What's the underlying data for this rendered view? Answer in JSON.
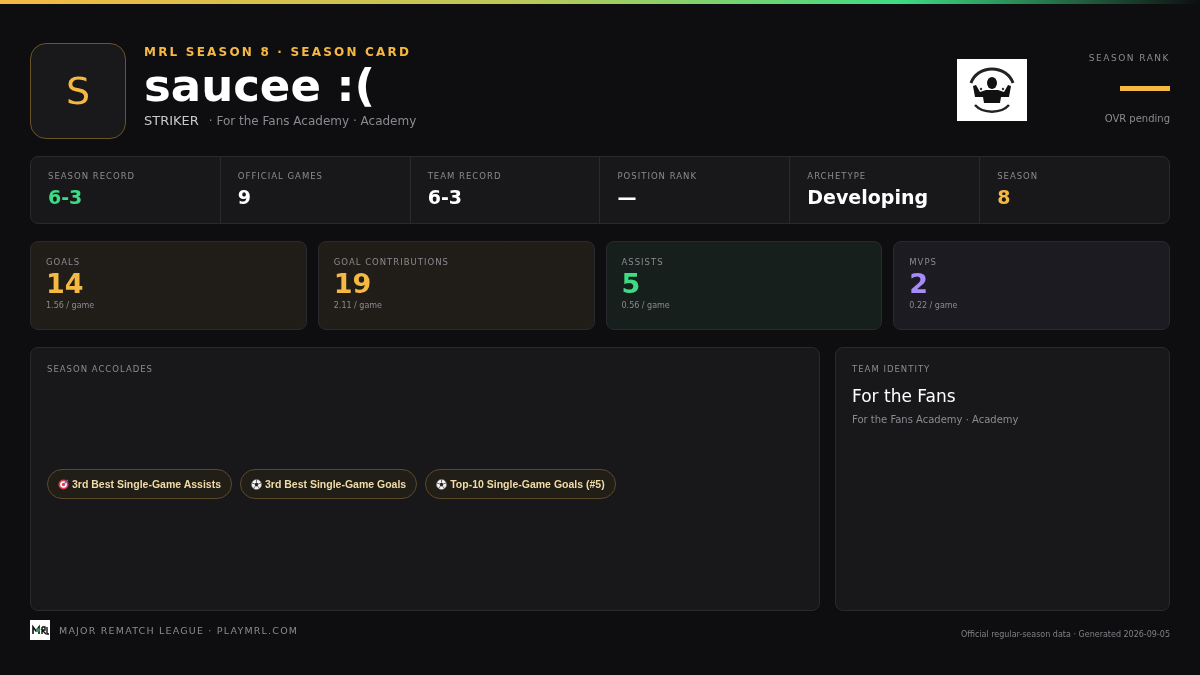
{
  "header": {
    "avatar_letter": "S",
    "eyebrow": "MRL SEASON 8 · SEASON CARD",
    "player_name": "saucee :(",
    "position": "STRIKER",
    "team_line": "· For the Fans Academy · Academy"
  },
  "season_rank": {
    "label": "SEASON RANK",
    "note": "OVR pending"
  },
  "summary": [
    {
      "label": "SEASON RECORD",
      "value": "6-3",
      "color": "#3ddc84"
    },
    {
      "label": "OFFICIAL GAMES",
      "value": "9",
      "color": "#ffffff"
    },
    {
      "label": "TEAM RECORD",
      "value": "6-3",
      "color": "#ffffff"
    },
    {
      "label": "POSITION RANK",
      "value": "—",
      "color": "#ffffff"
    },
    {
      "label": "ARCHETYPE",
      "value": "Developing",
      "color": "#ffffff"
    },
    {
      "label": "SEASON",
      "value": "8",
      "color": "#f5b942"
    }
  ],
  "stat_cards": [
    {
      "label": "GOALS",
      "value": "14",
      "per_game": "1.56 / game",
      "color": "#f5b942"
    },
    {
      "label": "GOAL CONTRIBUTIONS",
      "value": "19",
      "per_game": "2.11 / game",
      "color": "#f5b942"
    },
    {
      "label": "ASSISTS",
      "value": "5",
      "per_game": "0.56 / game",
      "color": "#3ddc84"
    },
    {
      "label": "MVPS",
      "value": "2",
      "per_game": "0.22 / game",
      "color": "#a78bfa"
    }
  ],
  "accolades": {
    "title": "SEASON ACCOLADES",
    "items": [
      {
        "kind": "target",
        "label": "3rd Best Single-Game Assists"
      },
      {
        "kind": "ball",
        "label": "3rd Best Single-Game Goals"
      },
      {
        "kind": "ball",
        "label": "Top-10 Single-Game Goals (#5)"
      }
    ]
  },
  "team_identity": {
    "title": "TEAM IDENTITY",
    "name": "For the Fans",
    "subtitle": "For the Fans Academy · Academy"
  },
  "footer": {
    "brand": "MAJOR REMATCH LEAGUE · PLAYMRL.COM",
    "note": "Official regular-season data · Generated 2026-09-05"
  }
}
